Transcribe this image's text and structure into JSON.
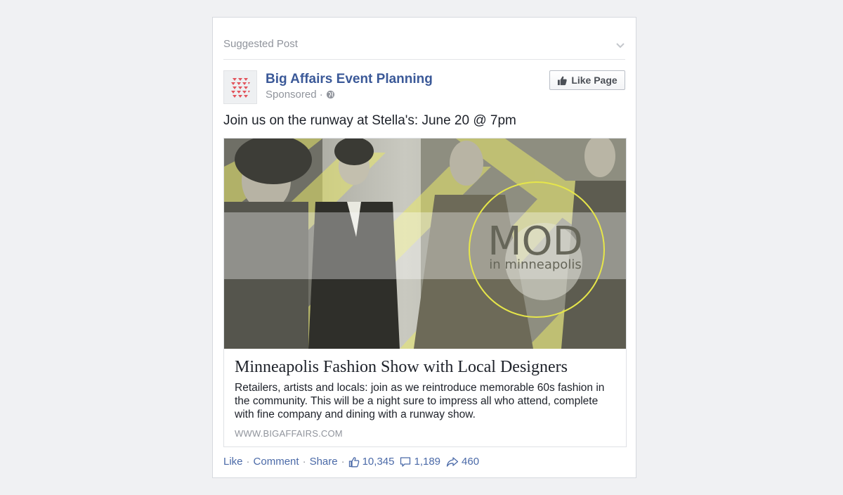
{
  "post": {
    "suggested_label": "Suggested Post",
    "page_name": "Big Affairs Event Planning",
    "sponsored": "Sponsored ·",
    "like_page_label": "Like Page",
    "message": "Join us on the runway at Stella's: June 20 @ 7pm"
  },
  "link_preview": {
    "hero_title": "MOD",
    "hero_subtitle": "in minneapolis",
    "title": "Minneapolis Fashion Show with Local Designers",
    "description": "Retailers, artists and locals: join as we reintroduce memorable 60s fashion in the community. This will be a night sure to impress all who attend, complete with fine company and dining with a runway show.",
    "domain": "WWW.BIGAFFAIRS.COM"
  },
  "actions": {
    "like": "Like",
    "comment": "Comment",
    "share": "Share",
    "likes_count": "10,345",
    "comments_count": "1,189",
    "shares_count": "460"
  },
  "icons": {
    "chevron": "chevron-down-icon",
    "globe": "globe-icon",
    "thumbs_up": "thumbs-up-icon",
    "comment": "comment-icon",
    "share": "share-icon"
  },
  "colors": {
    "link_blue": "#3b5998",
    "secondary_text": "#90949c",
    "accent_yellow": "#e8e86a"
  }
}
